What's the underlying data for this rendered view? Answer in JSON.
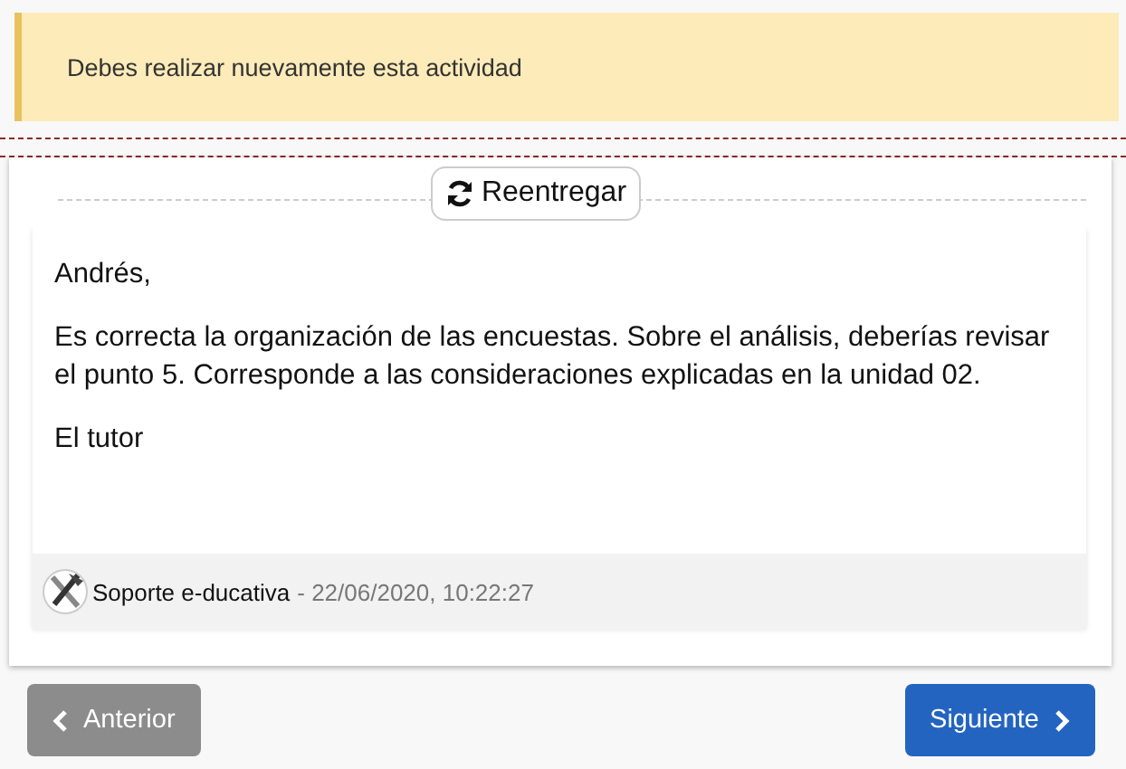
{
  "alert": {
    "text": "Debes realizar nuevamente esta actividad"
  },
  "resubmit_button": {
    "label": "Reentregar"
  },
  "message": {
    "paragraphs": [
      "Andrés,",
      "Es correcta la organización de las encuestas. Sobre el análisis, deberías revisar el punto 5. Corresponde a las consideraciones explicadas en la unidad 02.",
      "El tutor"
    ],
    "author": "Soporte e-ducativa",
    "timestamp": "- 22/06/2020, 10:22:27"
  },
  "navigation": {
    "previous": {
      "label": "Anterior",
      "disabled": true
    },
    "next": {
      "label": "Siguiente",
      "disabled": false
    }
  }
}
